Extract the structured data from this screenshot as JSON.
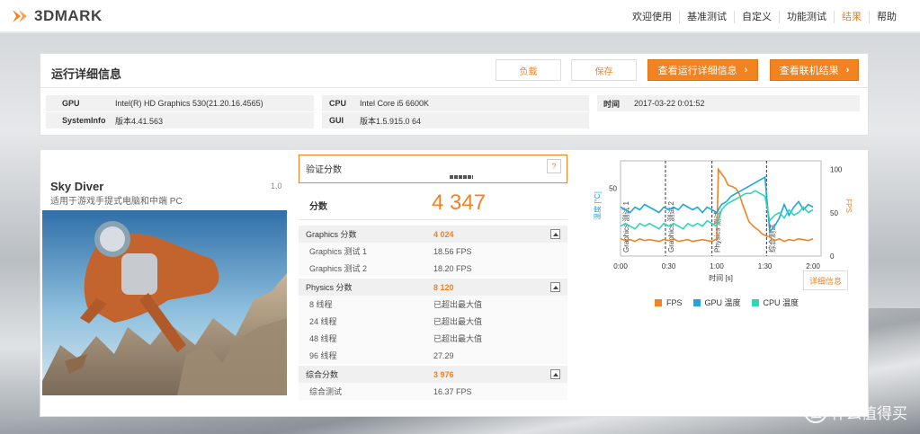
{
  "header": {
    "logo_text": "3DMARK",
    "nav": [
      "欢迎使用",
      "基准测试",
      "自定义",
      "功能测试",
      "结果",
      "帮助"
    ],
    "active_index": 4,
    "accent": "#f18323"
  },
  "details": {
    "title": "运行详细信息",
    "load_label": "负载",
    "save_label": "保存",
    "view_details_label": "查看运行详细信息",
    "view_online_label": "查看联机结果",
    "gpu_label": "GPU",
    "gpu_value": "Intel(R) HD Graphics 530(21.20.16.4565)",
    "sysinfo_label": "SystemInfo",
    "sysinfo_value": "版本4.41.563",
    "cpu_label": "CPU",
    "cpu_value": "Intel Core i5 6600K",
    "gui_label": "GUI",
    "gui_value": "版本1.5.915.0 64",
    "time_label": "时间",
    "time_value": "2017-03-22 0:01:52"
  },
  "test": {
    "name": "Sky Diver",
    "version": "1.0",
    "description": "适用于游戏手提式电脑和中端 PC"
  },
  "score": {
    "verify_label": "验证分数",
    "help": "?",
    "score_label": "分数",
    "score_value": "4 347"
  },
  "rows": [
    {
      "type": "head",
      "label": "Graphics 分数",
      "value": "4 024"
    },
    {
      "type": "sub",
      "label": "Graphics 测试 1",
      "value": "18.56 FPS"
    },
    {
      "type": "sub",
      "label": "Graphics 测试 2",
      "value": "18.20 FPS"
    },
    {
      "type": "head",
      "label": "Physics 分数",
      "value": "8 120"
    },
    {
      "type": "sub",
      "label": "8 线程",
      "value": "已超出最大值"
    },
    {
      "type": "sub",
      "label": "24 线程",
      "value": "已超出最大值"
    },
    {
      "type": "sub",
      "label": "48 线程",
      "value": "已超出最大值"
    },
    {
      "type": "sub",
      "label": "96 线程",
      "value": "27.29"
    },
    {
      "type": "head",
      "label": "综合分数",
      "value": "3 976"
    },
    {
      "type": "sub",
      "label": "综合测试",
      "value": "16.37 FPS"
    }
  ],
  "chart": {
    "detail_button": "详细信息",
    "xlabel": "时间 [s]",
    "ylabel_left": "温度 [°C]",
    "ylabel_right": "FPS",
    "xticks": [
      "0:00",
      "0:30",
      "1:00",
      "1:30",
      "2:00"
    ],
    "yticks_left": [
      "50"
    ],
    "yticks_right": [
      "100",
      "50",
      "0"
    ],
    "markers": [
      "Graphics 测试 1",
      "Graphics 测试 2",
      "Physics 测试",
      "综合测试"
    ],
    "legend": [
      {
        "name": "FPS",
        "color": "#f18323"
      },
      {
        "name": "GPU 温度",
        "color": "#1ea7d8"
      },
      {
        "name": "CPU 温度",
        "color": "#2fd6b8"
      }
    ]
  },
  "chart_data": {
    "type": "line",
    "xlabel": "时间 [s]",
    "xlim": [
      0,
      125
    ],
    "series": [
      {
        "name": "FPS",
        "axis": "right",
        "x": [
          0,
          3,
          6,
          9,
          12,
          15,
          18,
          21,
          24,
          27,
          30,
          33,
          36,
          39,
          42,
          45,
          48,
          51,
          54,
          57,
          60,
          61,
          63,
          65,
          67,
          70,
          72,
          74,
          76,
          78,
          80,
          83,
          86,
          88,
          90,
          93,
          96,
          99,
          102,
          105,
          108,
          111,
          114,
          117,
          120
        ],
        "values": [
          20,
          18,
          19,
          17,
          20,
          18,
          19,
          18,
          17,
          19,
          18,
          20,
          17,
          18,
          19,
          17,
          18,
          19,
          18,
          17,
          20,
          100,
          95,
          90,
          82,
          80,
          78,
          72,
          60,
          50,
          40,
          34,
          30,
          26,
          24,
          22,
          18,
          20,
          17,
          19,
          18,
          20,
          19,
          18,
          20
        ]
      },
      {
        "name": "GPU 温度",
        "axis": "left",
        "x": [
          0,
          3,
          6,
          9,
          12,
          15,
          18,
          21,
          24,
          27,
          30,
          33,
          36,
          39,
          42,
          45,
          48,
          51,
          54,
          57,
          60,
          63,
          66,
          69,
          72,
          75,
          78,
          81,
          84,
          87,
          90,
          93,
          96,
          99,
          102,
          105,
          108,
          111,
          114,
          117,
          120
        ],
        "values": [
          43,
          42,
          41,
          43,
          42,
          44,
          43,
          42,
          41,
          43,
          42,
          43,
          42,
          44,
          43,
          42,
          43,
          41,
          43,
          42,
          41,
          44,
          45,
          47,
          48,
          49,
          50,
          51,
          52,
          53,
          54,
          34,
          36,
          39,
          44,
          40,
          43,
          45,
          42,
          44,
          43
        ]
      },
      {
        "name": "CPU 温度",
        "axis": "left",
        "x": [
          0,
          3,
          6,
          9,
          12,
          15,
          18,
          21,
          24,
          27,
          30,
          33,
          36,
          39,
          42,
          45,
          48,
          51,
          54,
          57,
          60,
          63,
          66,
          69,
          72,
          75,
          78,
          81,
          84,
          87,
          90,
          93,
          96,
          99,
          102,
          105,
          108,
          111,
          114,
          117,
          120
        ],
        "values": [
          36,
          37,
          36,
          35,
          37,
          36,
          37,
          36,
          35,
          37,
          36,
          37,
          36,
          35,
          37,
          36,
          37,
          36,
          38,
          37,
          36,
          42,
          44,
          45,
          46,
          47,
          48,
          48,
          49,
          48,
          47,
          38,
          40,
          41,
          39,
          42,
          40,
          41,
          43,
          41,
          42
        ]
      }
    ]
  }
}
